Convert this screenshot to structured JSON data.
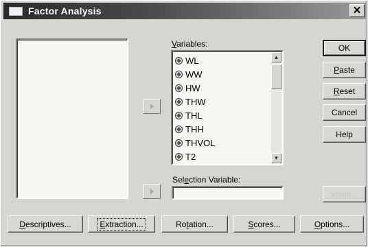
{
  "dialog": {
    "title": "Factor Analysis",
    "close_glyph": "✕"
  },
  "variables": {
    "label_mnemonic": "V",
    "label_rest": "ariables:",
    "items": [
      "WL",
      "WW",
      "HW",
      "THW",
      "THL",
      "THH",
      "THVOL",
      "T2"
    ]
  },
  "selection_variable": {
    "label_pre": "Sel",
    "label_mnemonic": "e",
    "label_post": "ction Variable:",
    "value": ""
  },
  "side_buttons": {
    "ok": {
      "label": "OK"
    },
    "paste": {
      "mnemonic": "P",
      "rest": "aste"
    },
    "reset": {
      "mnemonic": "R",
      "rest": "eset"
    },
    "cancel": {
      "label": "Cancel"
    },
    "help": {
      "label": "Help"
    },
    "value_disabled": {
      "label": "Value..."
    }
  },
  "bottom_buttons": {
    "descriptives": {
      "mnemonic": "D",
      "rest": "escriptives..."
    },
    "extraction": {
      "mnemonic": "E",
      "rest": "xtraction..."
    },
    "rotation": {
      "pre": "Ro",
      "mnemonic": "t",
      "post": "ation..."
    },
    "scores": {
      "mnemonic": "S",
      "rest": "cores..."
    },
    "options": {
      "mnemonic": "O",
      "rest": "ptions..."
    }
  },
  "scrollbar": {
    "up_glyph": "▲",
    "down_glyph": "▼"
  },
  "icons": {
    "variable": "scale-variable-icon",
    "move": "arrow-right-icon"
  },
  "colors": {
    "titlebar_start": "#2a2a2a",
    "titlebar_end": "#9a9a9a",
    "dialog_bg": "#d6d6d0"
  }
}
